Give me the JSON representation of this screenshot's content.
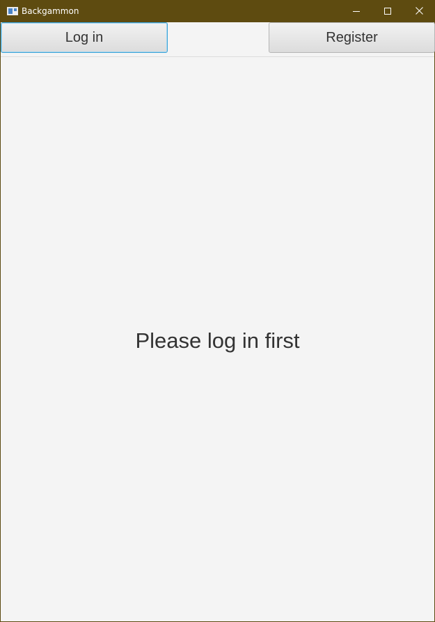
{
  "window": {
    "title": "Backgammon",
    "titlebar_color": "#5e4b10",
    "icon": "app-window-icon"
  },
  "titlebar_buttons": {
    "minimize_icon": "minimize-icon",
    "maximize_icon": "maximize-icon",
    "close_icon": "close-icon"
  },
  "toolbar": {
    "login_label": "Log in",
    "register_label": "Register",
    "focus_color": "#3aa3d8"
  },
  "main": {
    "message": "Please log in first"
  }
}
